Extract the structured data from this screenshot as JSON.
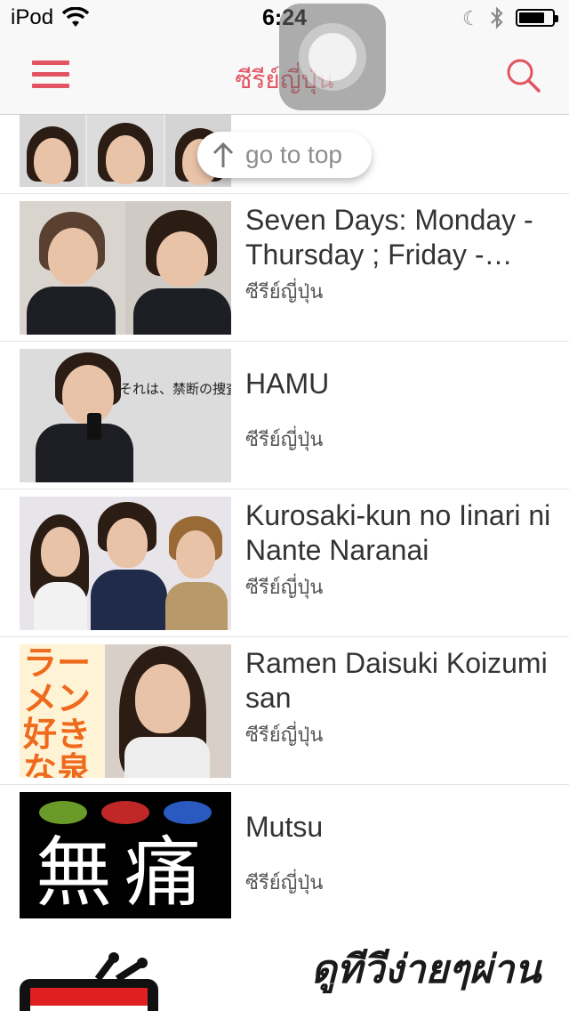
{
  "status_bar": {
    "carrier": "iPod",
    "time": "6:24"
  },
  "nav": {
    "title": "ซีรีย์ญี่ปุ่น",
    "menu_icon": "hamburger-menu-icon",
    "search_icon": "search-icon",
    "accent_color": "#e25461"
  },
  "go_to_top": {
    "label": "go to top"
  },
  "items": [
    {
      "title": "",
      "category": ""
    },
    {
      "title": "Seven Days: Monday - Thursday ; Friday -…",
      "category": "ซีรีย์ญี่ปุ่น"
    },
    {
      "title": "HAMU",
      "category": "ซีรีย์ญี่ปุ่น",
      "poster_text": "それは、禁断の捜査。"
    },
    {
      "title": "Kurosaki-kun no Iinari ni Nante Naranai",
      "category": "ซีรีย์ญี่ปุ่น"
    },
    {
      "title": "Ramen Daisuki Koizumi san",
      "category": "ซีรีย์ญี่ปุ่น",
      "poster_text": "ラーメン好きな泉さん"
    },
    {
      "title": "Mutsu",
      "category": "ซีรีย์ญี่ปุ่น",
      "poster_text": "無痛"
    }
  ],
  "banner": {
    "text": "ดูทีวีง่ายๆผ่าน"
  }
}
